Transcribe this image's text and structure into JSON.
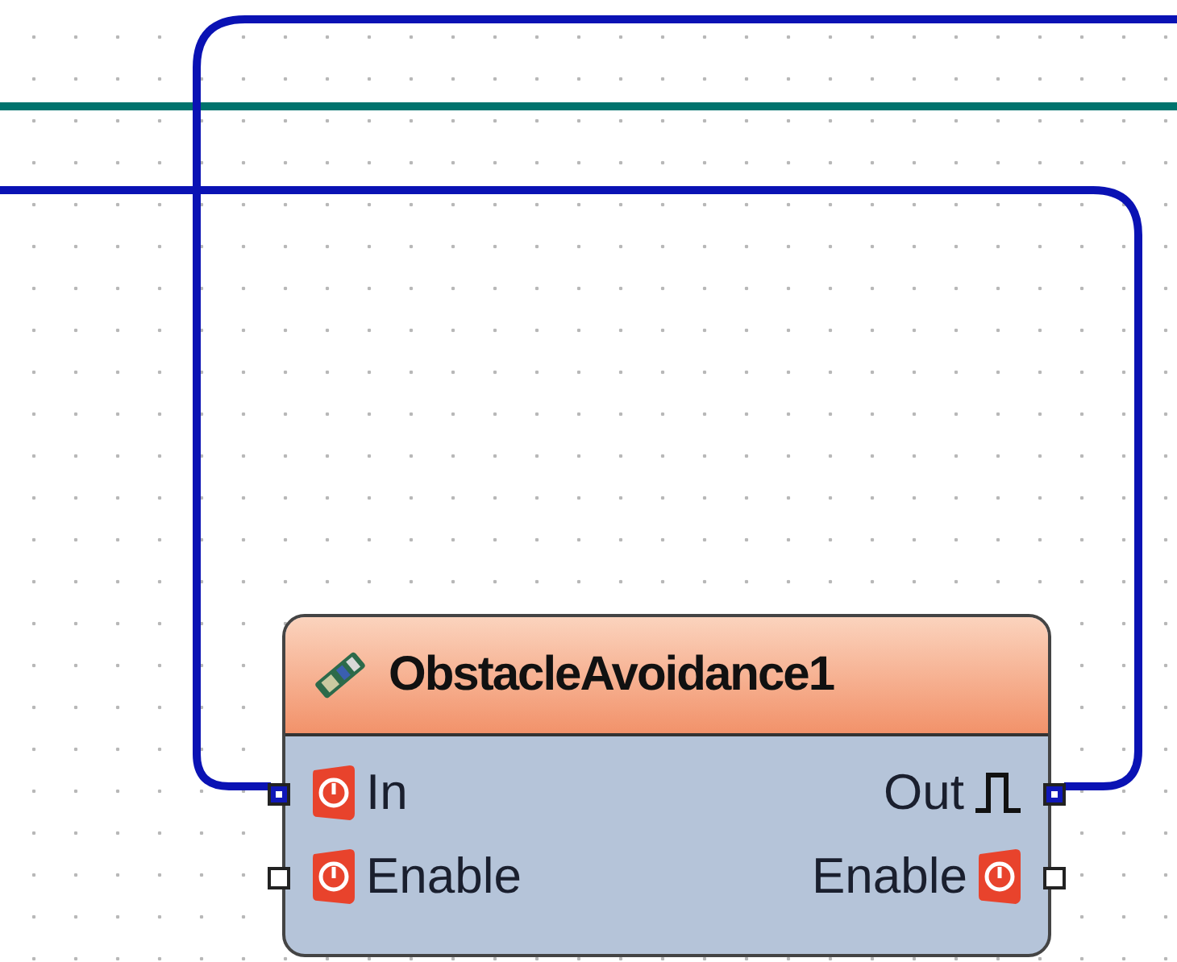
{
  "component": {
    "title": "ObstacleAvoidance1",
    "inputs": [
      {
        "label": "In",
        "kind": "digital",
        "connected": true
      },
      {
        "label": "Enable",
        "kind": "digital",
        "connected": false
      }
    ],
    "outputs": [
      {
        "label": "Out",
        "kind": "clock",
        "connected": true
      },
      {
        "label": "Enable",
        "kind": "digital",
        "connected": false
      }
    ]
  }
}
